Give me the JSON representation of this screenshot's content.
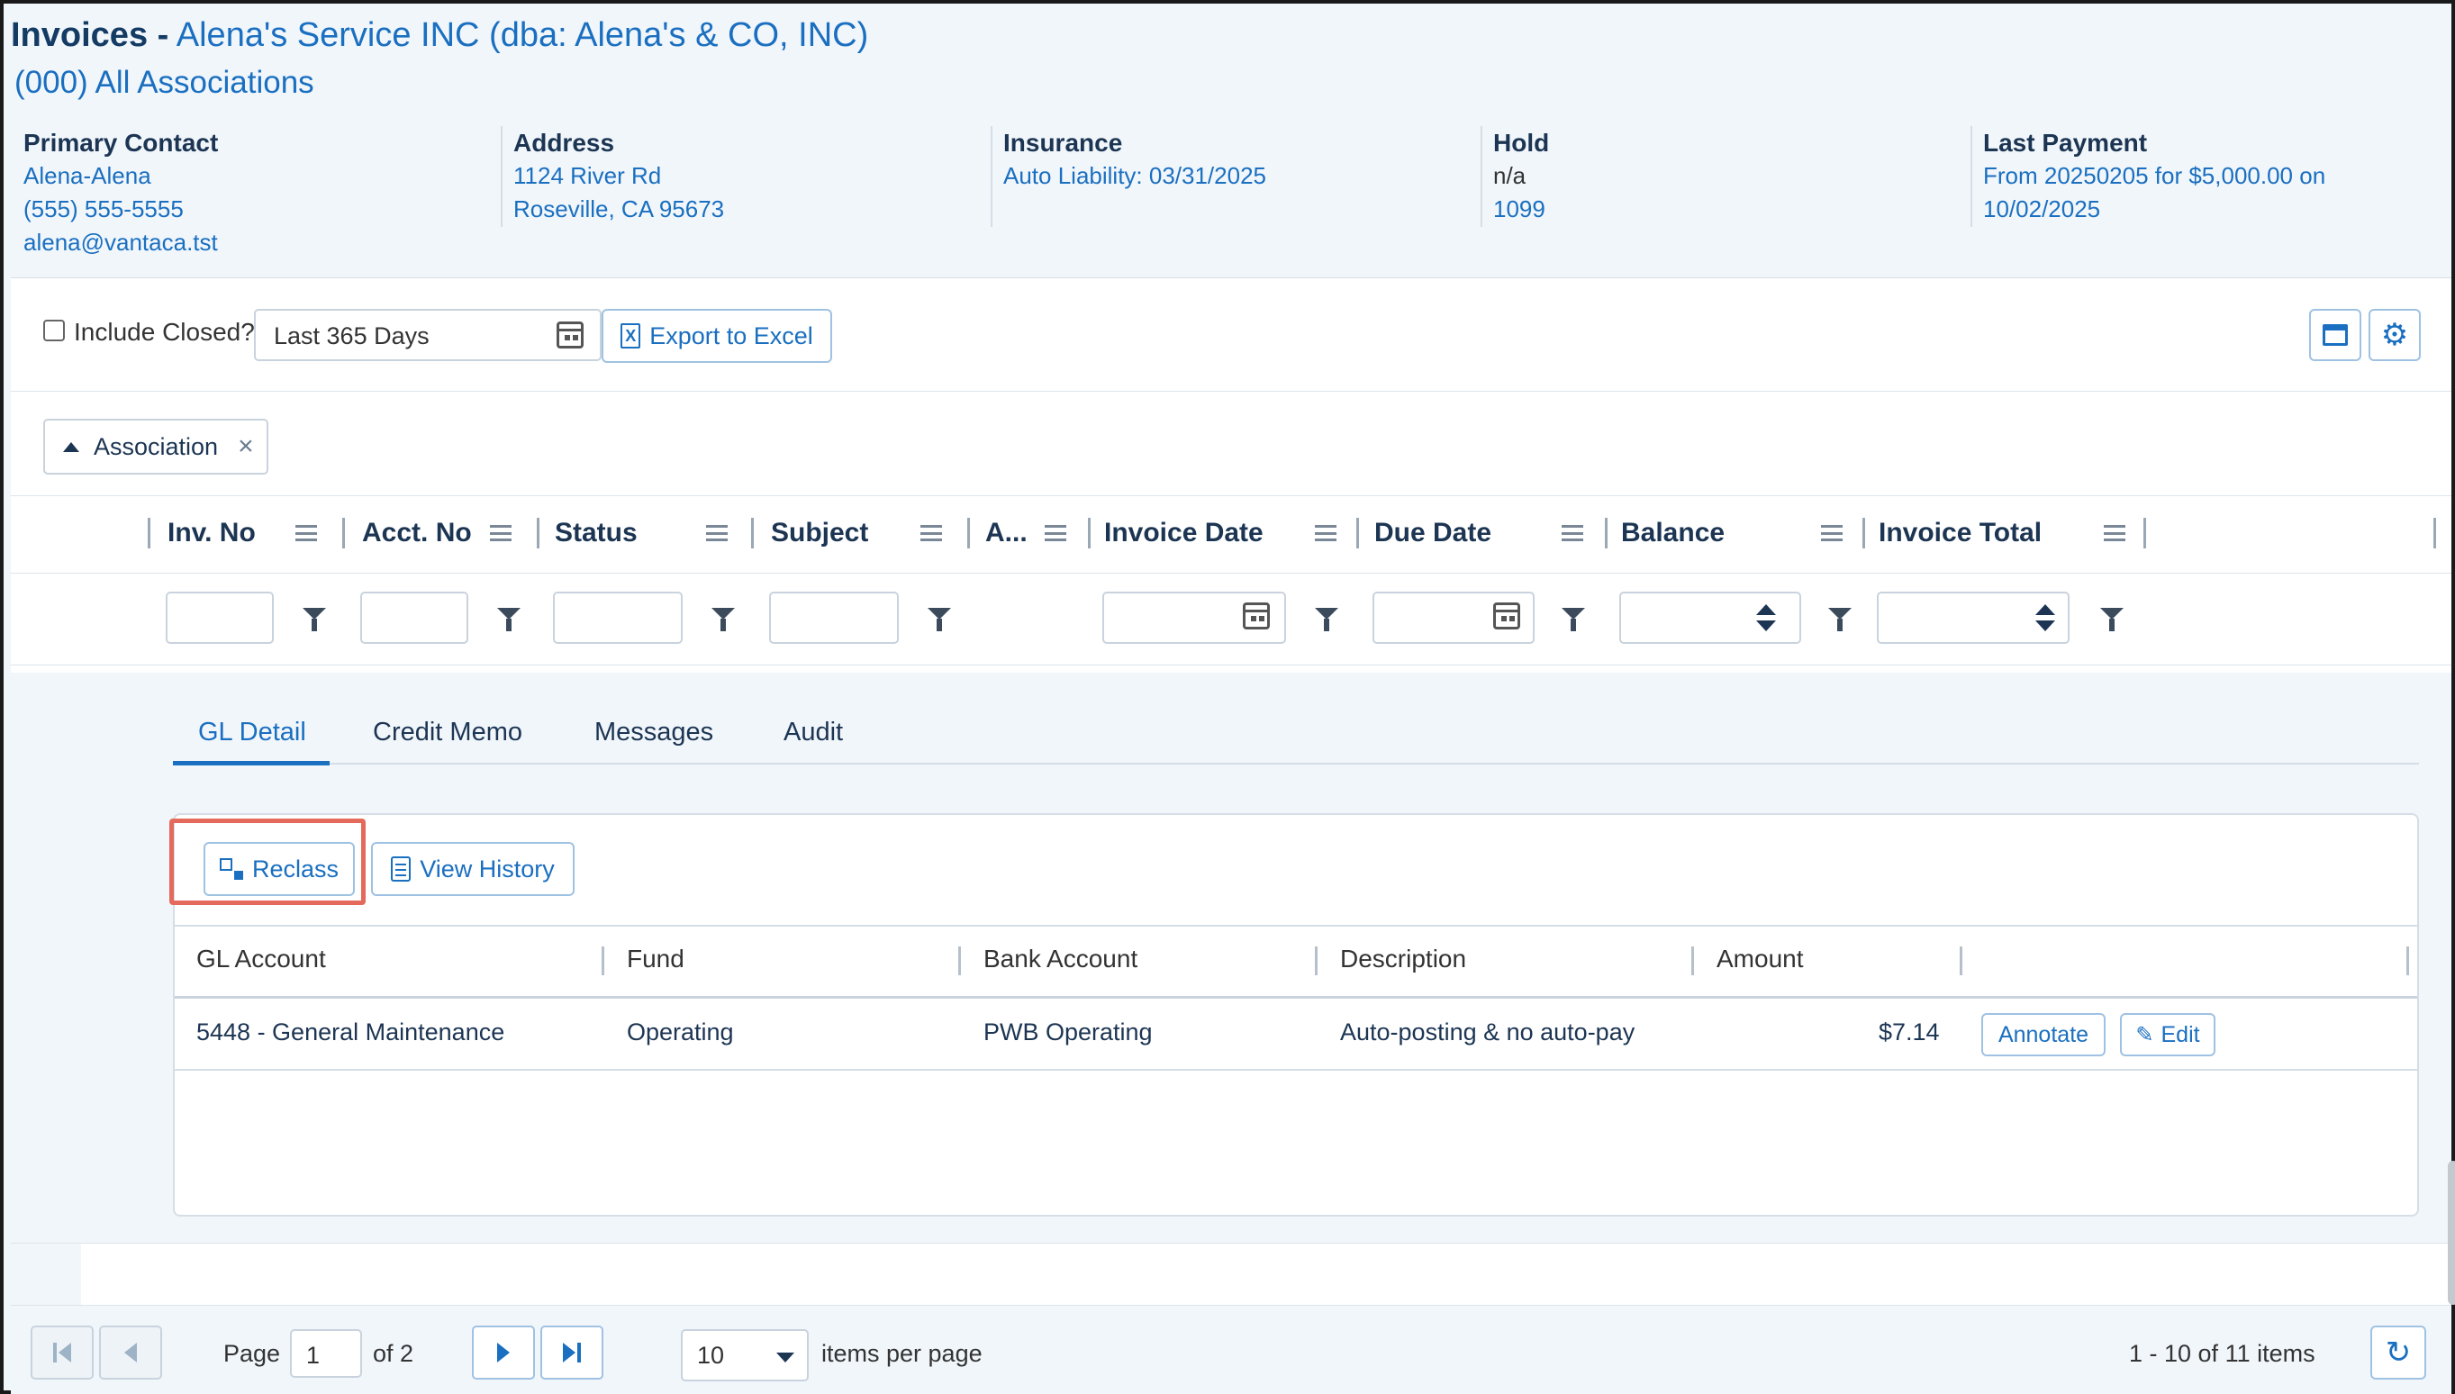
{
  "header": {
    "title_prefix": "Invoices -",
    "vendor": "Alena's Service INC (dba: Alena's & CO, INC)",
    "association": "(000) All Associations"
  },
  "info": {
    "primary_contact": {
      "label": "Primary Contact",
      "name": "Alena-Alena",
      "phone": "(555) 555-5555",
      "email": "alena@vantaca.tst"
    },
    "address": {
      "label": "Address",
      "line1": "1124 River Rd",
      "line2": "Roseville, CA 95673"
    },
    "insurance": {
      "label": "Insurance",
      "value": "Auto Liability: 03/31/2025"
    },
    "hold": {
      "label": "Hold",
      "value": "n/a",
      "tax": "1099"
    },
    "last_payment": {
      "label": "Last Payment",
      "line1": "From 20250205 for $5,000.00 on",
      "line2": "10/02/2025"
    }
  },
  "toolbar": {
    "include_closed_label": "Include Closed?",
    "include_closed_checked": false,
    "date_range": "Last 365 Days",
    "export_label": "Export to Excel",
    "excel_glyph": "X"
  },
  "grouping": {
    "chip_label": "Association",
    "remove_glyph": "×"
  },
  "grid": {
    "columns": [
      "Inv. No",
      "Acct. No",
      "Status",
      "Subject",
      "A...",
      "Invoice Date",
      "Due Date",
      "Balance",
      "Invoice Total"
    ]
  },
  "detail": {
    "tabs": [
      "GL Detail",
      "Credit Memo",
      "Messages",
      "Audit"
    ],
    "active_tab": "GL Detail",
    "reclass_label": "Reclass",
    "view_history_label": "View History",
    "gl_columns": [
      "GL Account",
      "Fund",
      "Bank Account",
      "Description",
      "Amount"
    ],
    "gl_rows": [
      {
        "gl_account": "5448 - General Maintenance",
        "fund": "Operating",
        "bank_account": "PWB Operating",
        "description": "Auto-posting & no auto-pay",
        "amount": "$7.14",
        "annotate_label": "Annotate",
        "edit_label": "Edit"
      }
    ]
  },
  "pager": {
    "page_label": "Page",
    "current_page": "1",
    "of_label": "of 2",
    "page_size": "10",
    "items_per_page_label": "items per page",
    "summary": "1 - 10 of 11 items"
  },
  "icons": {
    "gear": "⚙",
    "pencil": "✎",
    "refresh": "↻"
  },
  "colors": {
    "accent": "#1a6fc0",
    "highlight": "#e46b5c"
  }
}
